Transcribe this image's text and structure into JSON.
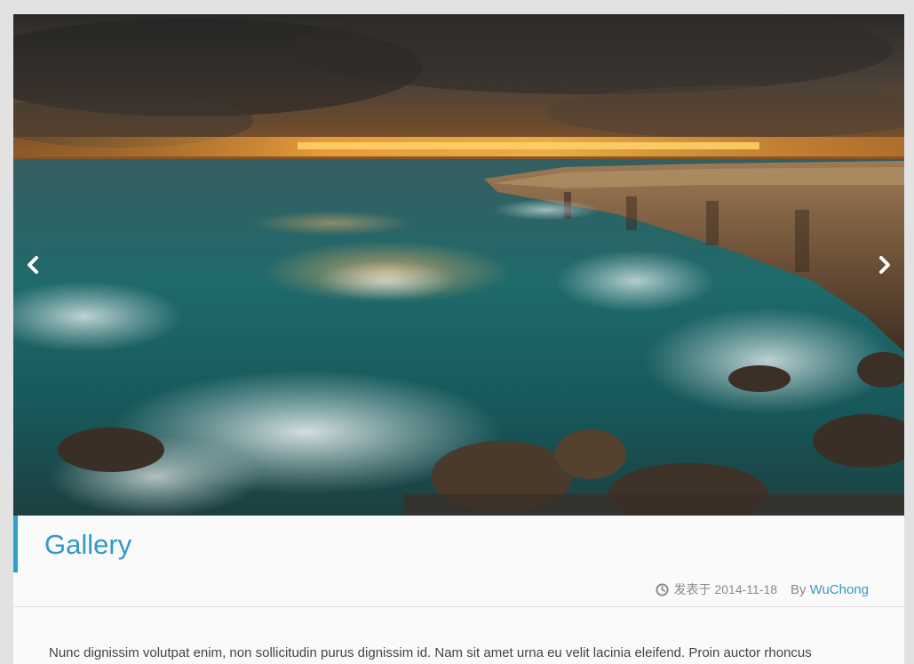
{
  "slider": {
    "image_alt": "Stormy sunset over sea cliffs with crashing waves",
    "prev_icon": "chevron-left-icon",
    "next_icon": "chevron-right-icon"
  },
  "post": {
    "title": "Gallery",
    "meta": {
      "clock_icon": "clock-icon",
      "date_label": "发表于",
      "date": "2014-11-18",
      "by_label": "By",
      "author": "WuChong"
    },
    "excerpt": "Nunc dignissim volutpat enim, non sollicitudin purus dignissim id. Nam sit amet urna eu velit lacinia eleifend. Proin auctor rhoncus"
  },
  "colors": {
    "accent": "#2d9fca",
    "link": "#3399c6",
    "background": "#e2e2e2",
    "card": "#fafafa"
  }
}
